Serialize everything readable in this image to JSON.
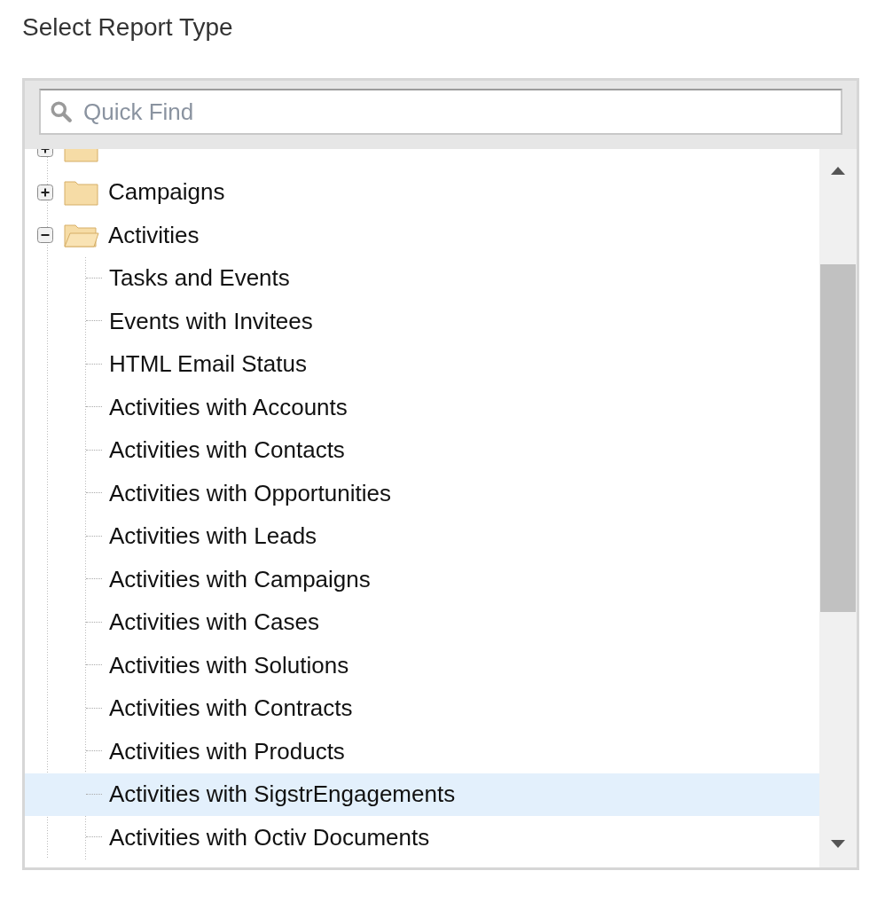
{
  "title": "Select Report Type",
  "search": {
    "placeholder": "Quick Find"
  },
  "tree": [
    {
      "expanded": false
    },
    {
      "label": "Campaigns",
      "expanded": false
    },
    {
      "label": "Activities",
      "expanded": true,
      "children": [
        {
          "label": "Tasks and Events",
          "selected": false
        },
        {
          "label": "Events with Invitees",
          "selected": false
        },
        {
          "label": "HTML Email Status",
          "selected": false
        },
        {
          "label": "Activities with Accounts",
          "selected": false
        },
        {
          "label": "Activities with Contacts",
          "selected": false
        },
        {
          "label": "Activities with Opportunities",
          "selected": false
        },
        {
          "label": "Activities with Leads",
          "selected": false
        },
        {
          "label": "Activities with Campaigns",
          "selected": false
        },
        {
          "label": "Activities with Cases",
          "selected": false
        },
        {
          "label": "Activities with Solutions",
          "selected": false
        },
        {
          "label": "Activities with Contracts",
          "selected": false
        },
        {
          "label": "Activities with Products",
          "selected": false
        },
        {
          "label": "Activities with SigstrEngagements",
          "selected": true
        },
        {
          "label": "Activities with Octiv Documents",
          "selected": false
        }
      ]
    }
  ]
}
